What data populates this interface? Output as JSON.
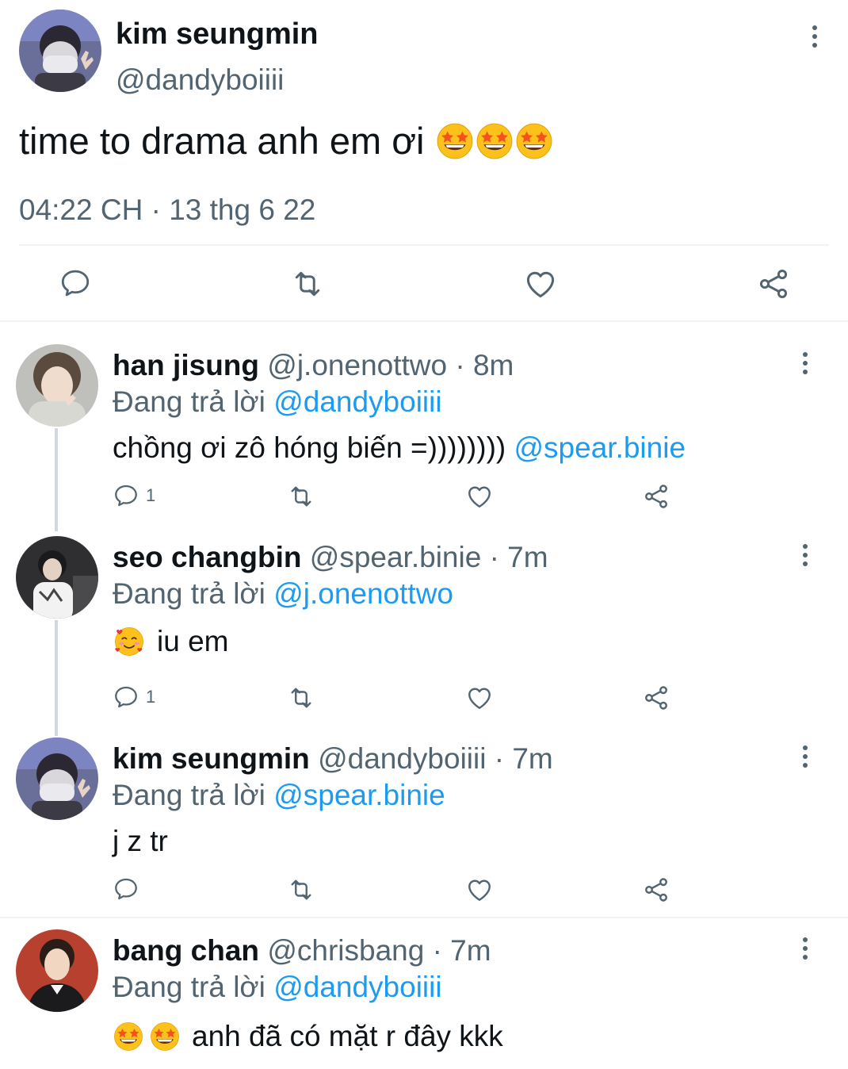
{
  "main_tweet": {
    "name": "kim seungmin",
    "handle": "@dandyboiiii",
    "text": "time to drama anh em ơi",
    "text_emoji": [
      "star-struck",
      "star-struck",
      "star-struck"
    ],
    "timestamp": "04:22 CH · 13 thg 6 22",
    "actions": [
      "reply-icon",
      "retweet-icon",
      "like-icon",
      "share-icon"
    ]
  },
  "replies": [
    {
      "name": "han jisung",
      "handle": "@j.onenottwo · 8m",
      "replying_prefix": "Đang trả lời ",
      "replying_to": "@dandyboiiii",
      "text": "chồng ơi zô hóng biến =)))))))) ",
      "mention": "@spear.binie",
      "reply_count": "1"
    },
    {
      "name": "seo changbin",
      "handle": "@spear.binie · 7m",
      "replying_prefix": "Đang trả lời ",
      "replying_to": "@j.onenottwo",
      "text_emoji": [
        "smiling-face-with-hearts"
      ],
      "text": "iu em",
      "reply_count": "1"
    },
    {
      "name": "kim seungmin",
      "handle": "@dandyboiiii · 7m",
      "replying_prefix": "Đang trả lời ",
      "replying_to": "@spear.binie",
      "text": "j z tr",
      "reply_count": ""
    },
    {
      "name": "bang chan",
      "handle": "@chrisbang · 7m",
      "replying_prefix": "Đang trả lời ",
      "replying_to": "@dandyboiiii",
      "text_emoji": [
        "star-struck",
        "star-struck"
      ],
      "text": "anh đã có mặt r đây kkk"
    }
  ],
  "colors": {
    "text": "#0f1419",
    "secondary": "#536471",
    "link": "#1d9bf0",
    "divider": "#eff3f4",
    "thread_line": "#cfd9de"
  }
}
